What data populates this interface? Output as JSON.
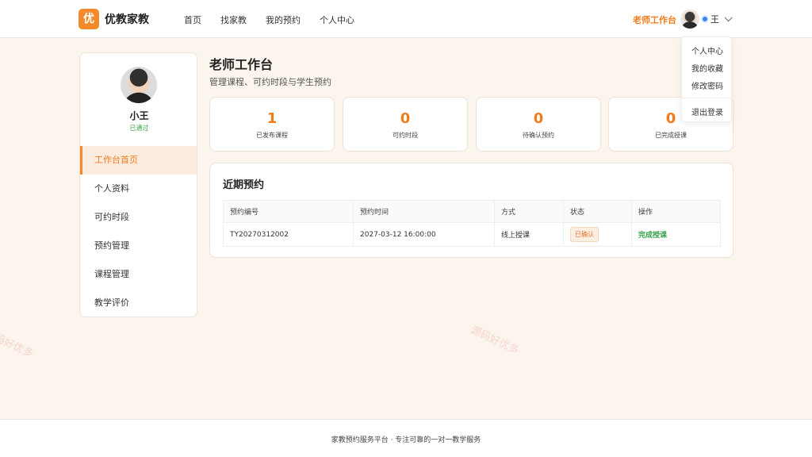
{
  "header": {
    "logo_char": "优",
    "brand": "优教家教",
    "nav": [
      "首页",
      "找家教",
      "我的预约",
      "个人中心"
    ],
    "teacher_link": "老师工作台",
    "user_name": "王"
  },
  "dropdown": {
    "items": [
      "个人中心",
      "我的收藏",
      "修改密码"
    ],
    "logout": "退出登录"
  },
  "sidebar": {
    "name": "小王",
    "status": "已通过",
    "menu": [
      "工作台首页",
      "个人资料",
      "可约时段",
      "预约管理",
      "课程管理",
      "教学评价"
    ],
    "active_index": 0
  },
  "main": {
    "title": "老师工作台",
    "subtitle": "管理课程、可约时段与学生预约",
    "stats": [
      {
        "value": "1",
        "label": "已发布课程"
      },
      {
        "value": "0",
        "label": "可约时段"
      },
      {
        "value": "0",
        "label": "待确认预约"
      },
      {
        "value": "0",
        "label": "已完成授课"
      }
    ],
    "recent": {
      "title": "近期预约",
      "columns": [
        "预约编号",
        "预约时间",
        "方式",
        "状态",
        "操作"
      ],
      "rows": [
        {
          "id": "TY20270312002",
          "time": "2027-03-12 16:00:00",
          "mode": "线上授课",
          "status": "已确认",
          "action": "完成授课"
        }
      ]
    }
  },
  "footer": {
    "text": "家教预约服务平台 · 专注可靠的一对一教学服务"
  },
  "watermarks": [
    "码好优多",
    "源码好优多",
    "码好优多"
  ],
  "colors": {
    "accent": "#f58a2c",
    "accent_text": "#f07c1c",
    "success": "#3aa14a",
    "background": "#fcf5ee"
  }
}
